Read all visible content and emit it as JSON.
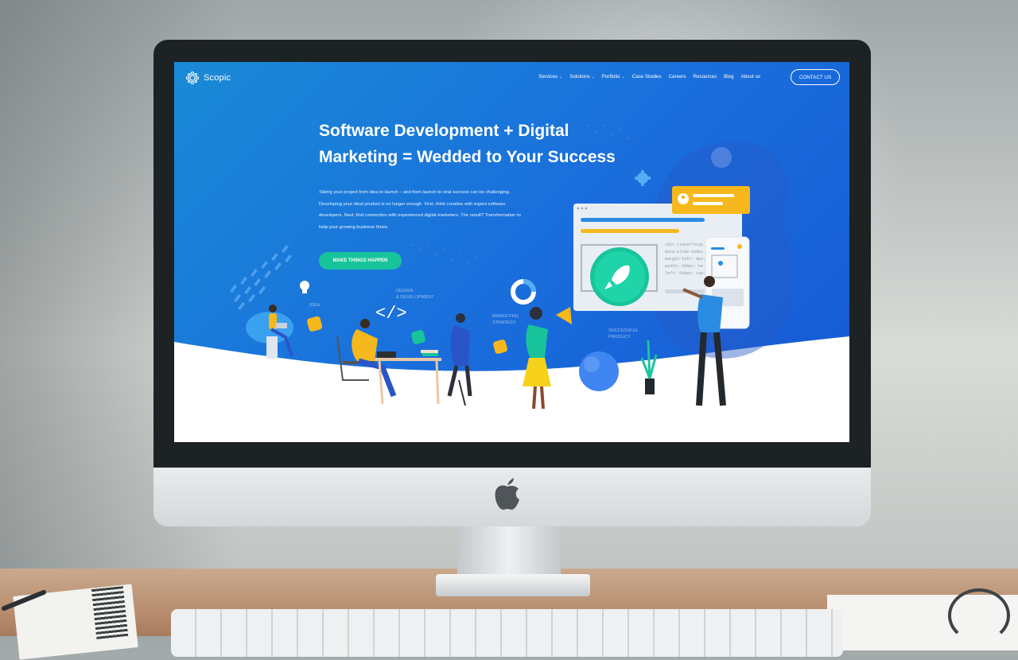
{
  "site": {
    "logo_text": "Scopic",
    "nav": [
      {
        "label": "Services",
        "has_dropdown": true
      },
      {
        "label": "Solutions",
        "has_dropdown": true
      },
      {
        "label": "Portfolio",
        "has_dropdown": true
      },
      {
        "label": "Case Studies",
        "has_dropdown": false
      },
      {
        "label": "Careers",
        "has_dropdown": false
      },
      {
        "label": "Resources",
        "has_dropdown": false
      },
      {
        "label": "Blog",
        "has_dropdown": false
      },
      {
        "label": "About us",
        "has_dropdown": false
      }
    ],
    "contact_label": "CONTACT US",
    "hero": {
      "title_line1": "Software Development + Digital",
      "title_line2": "Marketing = Wedded to Your Success",
      "paragraph": "Taking your project from idea to launch – and from launch to viral success can be challenging. Developing your ideal product is no longer enough. First, think creation with expert software developers. Next, find connection with experienced digital marketers. The result? Transformation to help your growing business thrive.",
      "cta_label": "MAKE THINGS HAPPEN"
    },
    "illustration": {
      "idea_label": "IDEA",
      "design_label_1": "DESIGN",
      "design_label_2": "& DEVELOPMENT",
      "marketing_label_1": "MARKETING",
      "marketing_label_2": "STRATEGY",
      "product_label_1": "SUCCESSFUL",
      "product_label_2": "PRODUCT",
      "code_line_1": "<div class=\"scop",
      "code_line_2": "data-slide-index",
      "code_line_3": "margin-left: 0px;",
      "code_line_4": "width: 290px; he",
      "code_line_5": "left: 590px; top:"
    },
    "colors": {
      "primary_blue": "#1a6fdc",
      "cta_green": "#18c49b",
      "accent_yellow": "#f6b81c"
    }
  }
}
